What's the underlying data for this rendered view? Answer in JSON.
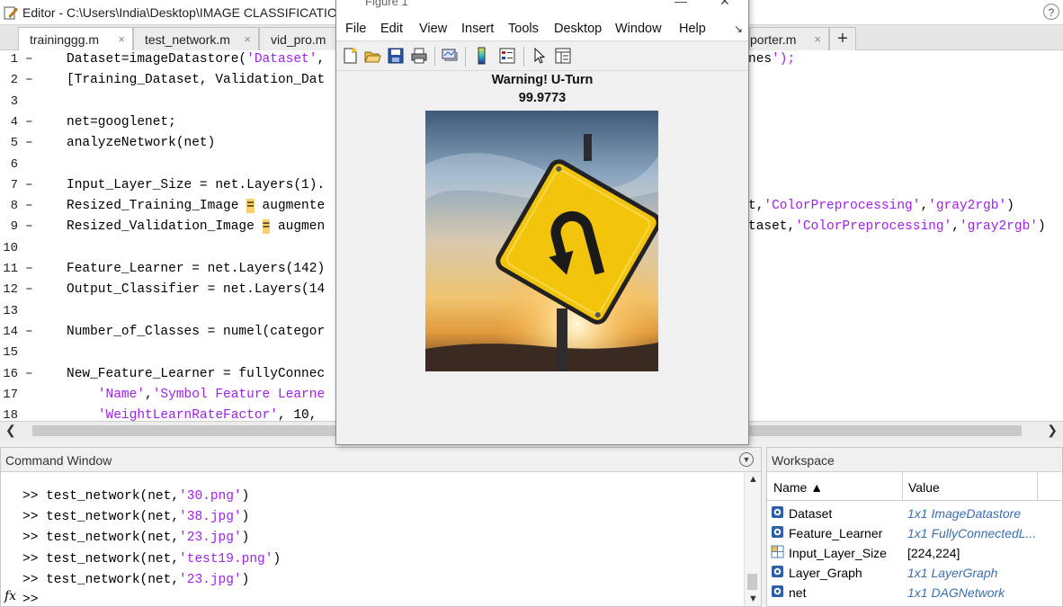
{
  "editor": {
    "title": "Editor - C:\\Users\\India\\Desktop\\IMAGE CLASSIFICATION\\",
    "help": "?",
    "tabs": [
      {
        "label": "traininggg.m",
        "close": "×"
      },
      {
        "label": "test_network.m",
        "close": "×"
      },
      {
        "label": "vid_pro.m",
        "close": ""
      },
      {
        "label": "porter.m",
        "close": "×"
      }
    ],
    "add_tab": "+",
    "lines": [
      {
        "n": "1",
        "dash": "–",
        "code": "Dataset=imageDatastore('Dataset',",
        "tail": "nes');"
      },
      {
        "n": "2",
        "dash": "–",
        "code": "[Training_Dataset, Validation_Dat",
        "tail": ""
      },
      {
        "n": "3",
        "dash": "",
        "code": "",
        "tail": ""
      },
      {
        "n": "4",
        "dash": "–",
        "code": "net=googlenet;",
        "tail": ""
      },
      {
        "n": "5",
        "dash": "–",
        "code": "analyzeNetwork(net)",
        "tail": ""
      },
      {
        "n": "6",
        "dash": "",
        "code": "",
        "tail": ""
      },
      {
        "n": "7",
        "dash": "–",
        "code": "Input_Layer_Size = net.Layers(1).",
        "tail": ""
      },
      {
        "n": "8",
        "dash": "–",
        "code": "Resized_Training_Image = augmente",
        "tail": "t,'ColorPreprocessing','gray2rgb')"
      },
      {
        "n": "9",
        "dash": "–",
        "code": "Resized_Validation_Image = augmen",
        "tail": "taset,'ColorPreprocessing','gray2rgb')"
      },
      {
        "n": "10",
        "dash": "",
        "code": "",
        "tail": ""
      },
      {
        "n": "11",
        "dash": "–",
        "code": "Feature_Learner = net.Layers(142)",
        "tail": ""
      },
      {
        "n": "12",
        "dash": "–",
        "code": "Output_Classifier = net.Layers(14",
        "tail": ""
      },
      {
        "n": "13",
        "dash": "",
        "code": "",
        "tail": ""
      },
      {
        "n": "14",
        "dash": "–",
        "code": "Number_of_Classes = numel(categor",
        "tail": ""
      },
      {
        "n": "15",
        "dash": "",
        "code": "",
        "tail": ""
      },
      {
        "n": "16",
        "dash": "–",
        "code": "New_Feature_Learner = fullyConnec",
        "tail": ""
      },
      {
        "n": "17",
        "dash": "",
        "code": "    'Name','Symbol Feature Learne",
        "tail": ""
      },
      {
        "n": "18",
        "dash": "",
        "code": "    'WeightLearnRateFactor', 10,",
        "tail": ""
      }
    ]
  },
  "command_window": {
    "title": "Command Window",
    "prompt": ">>",
    "history": [
      {
        "fn": "test_network(net,",
        "arg": "'30.png'",
        "end": ")"
      },
      {
        "fn": "test_network(net,",
        "arg": "'38.jpg'",
        "end": ")"
      },
      {
        "fn": "test_network(net,",
        "arg": "'23.jpg'",
        "end": ")"
      },
      {
        "fn": "test_network(net,",
        "arg": "'test19.png'",
        "end": ")"
      },
      {
        "fn": "test_network(net,",
        "arg": "'23.jpg'",
        "end": ")"
      }
    ],
    "fx": "fx"
  },
  "workspace": {
    "title": "Workspace",
    "col_name": "Name ▲",
    "col_value": "Value",
    "rows": [
      {
        "name": "Dataset",
        "value": "1x1 ImageDatastore",
        "icon": "object-icon"
      },
      {
        "name": "Feature_Learner",
        "value": "1x1 FullyConnectedL...",
        "icon": "object-icon"
      },
      {
        "name": "Input_Layer_Size",
        "value": "[224,224]",
        "icon": "matrix-icon"
      },
      {
        "name": "Layer_Graph",
        "value": "1x1 LayerGraph",
        "icon": "object-icon"
      },
      {
        "name": "net",
        "value": "1x1 DAGNetwork",
        "icon": "object-icon"
      }
    ]
  },
  "figure": {
    "title": "Figure 1",
    "menu": [
      "File",
      "Edit",
      "View",
      "Insert",
      "Tools",
      "Desktop",
      "Window",
      "Help"
    ],
    "plot_title": "Warning! U-Turn",
    "score": "99.9773",
    "image_subject": "u-turn road sign at sunset"
  },
  "colors": {
    "string": "#a020f0",
    "workspace_object_value": "#3a6fb0",
    "sign_yellow": "#f2c40c"
  }
}
